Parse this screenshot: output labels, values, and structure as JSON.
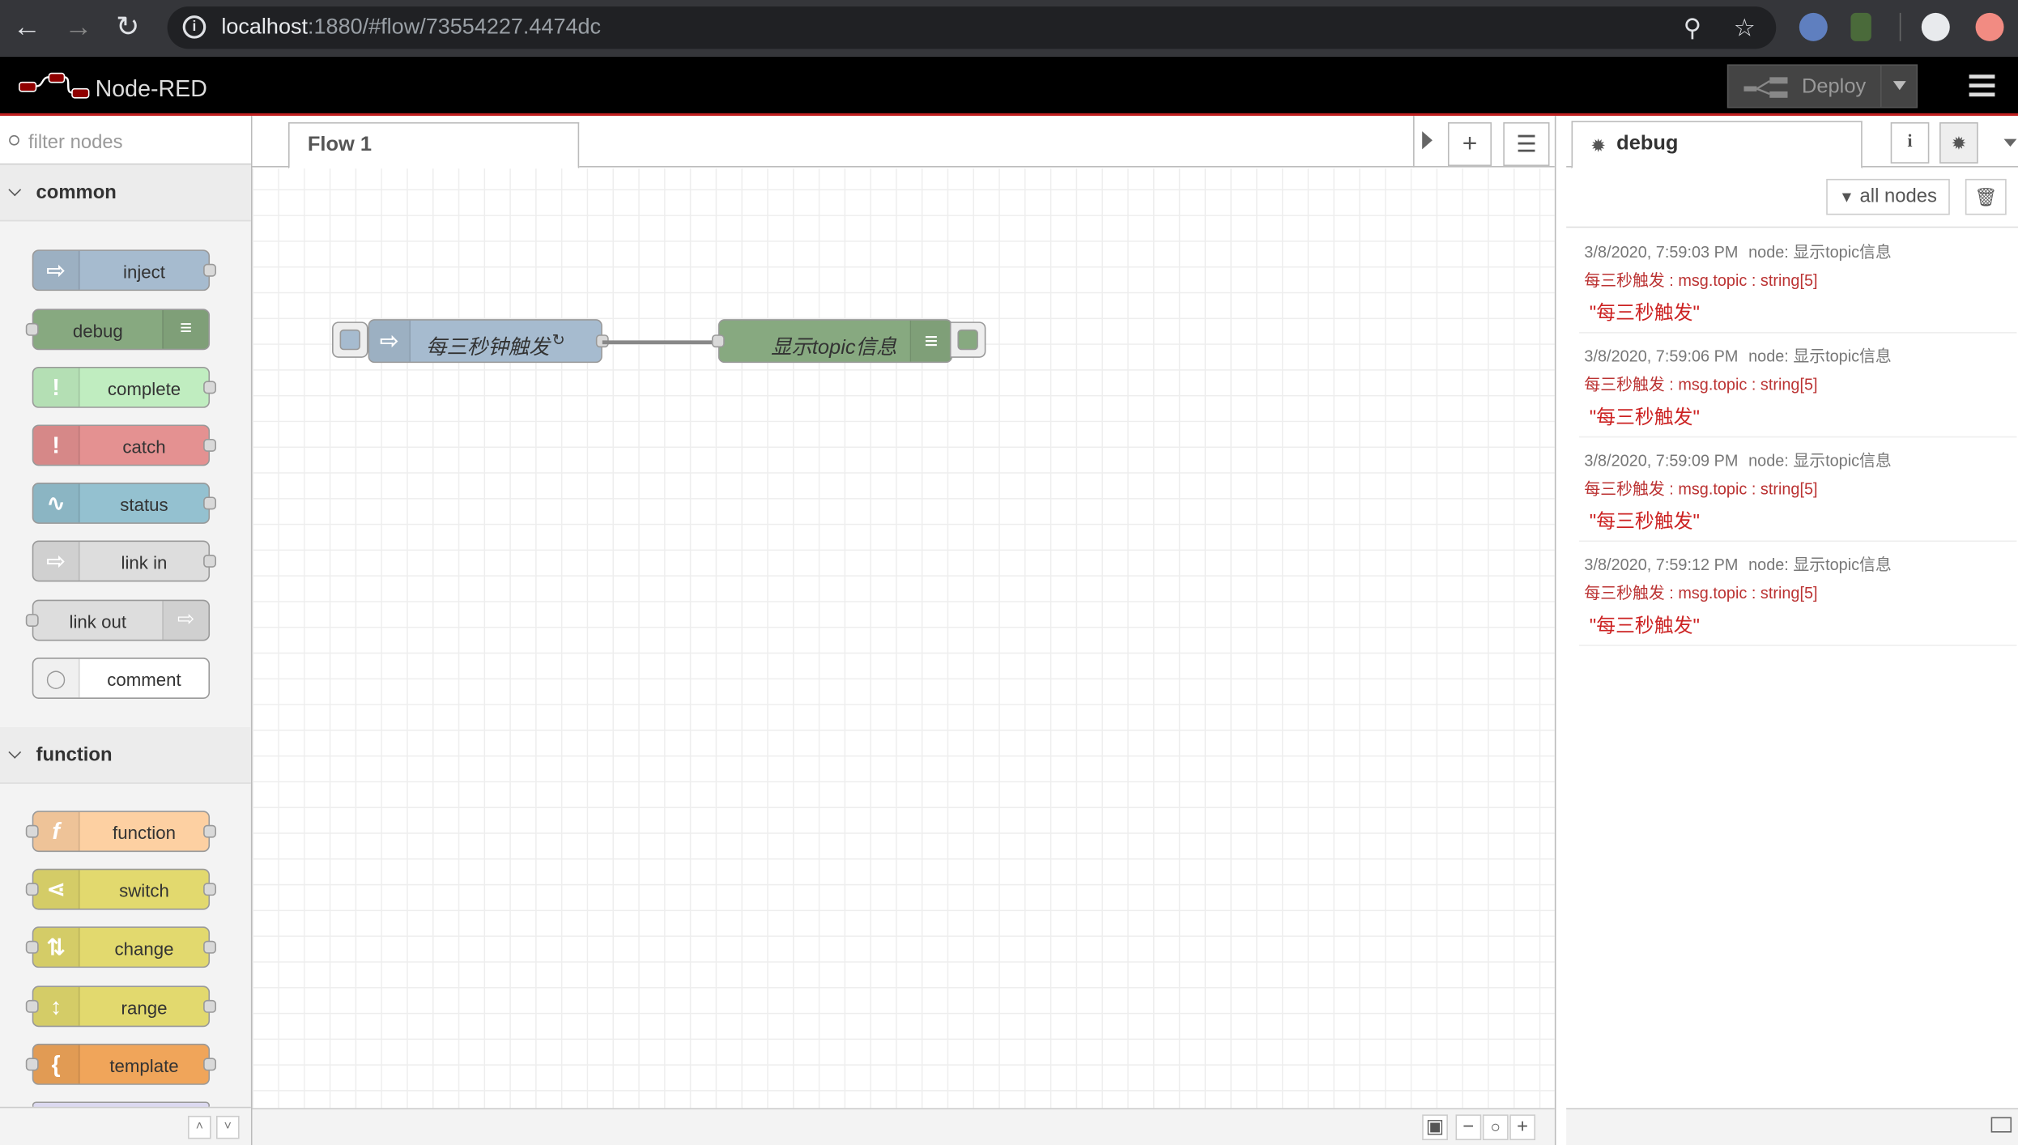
{
  "browser": {
    "url_host": "localhost",
    "url_rest": ":1880/#flow/73554227.4474dc"
  },
  "header": {
    "app_title": "Node-RED",
    "deploy_label": "Deploy"
  },
  "palette": {
    "filter_placeholder": "filter nodes",
    "categories": [
      {
        "label": "common",
        "nodes": [
          {
            "label": "inject",
            "color": "#a6bbcf"
          },
          {
            "label": "debug",
            "color": "#87a980"
          },
          {
            "label": "complete",
            "color": "#c0edc0"
          },
          {
            "label": "catch",
            "color": "#e49191"
          },
          {
            "label": "status",
            "color": "#94c1d0"
          },
          {
            "label": "link in",
            "color": "#dddddd"
          },
          {
            "label": "link out",
            "color": "#dddddd"
          },
          {
            "label": "comment",
            "color": "#ffffff"
          }
        ]
      },
      {
        "label": "function",
        "nodes": [
          {
            "label": "function",
            "color": "#fdd0a2"
          },
          {
            "label": "switch",
            "color": "#e2d96e"
          },
          {
            "label": "change",
            "color": "#e2d96e"
          },
          {
            "label": "range",
            "color": "#e2d96e"
          },
          {
            "label": "template",
            "color": "#f0a55a"
          }
        ]
      }
    ]
  },
  "workspace": {
    "tab_label": "Flow 1",
    "flow_nodes": [
      {
        "label": "每三秒钟触发",
        "color": "#a6bbcf"
      },
      {
        "label": "显示topic信息",
        "color": "#87a980"
      }
    ]
  },
  "sidebar": {
    "tab_label": "debug",
    "filter_label": "all nodes",
    "messages": [
      {
        "time": "3/8/2020, 7:59:03 PM",
        "node": "node: 显示topic信息",
        "path": "每三秒触发 : msg.topic : string[5]",
        "value": "\"每三秒触发\""
      },
      {
        "time": "3/8/2020, 7:59:06 PM",
        "node": "node: 显示topic信息",
        "path": "每三秒触发 : msg.topic : string[5]",
        "value": "\"每三秒触发\""
      },
      {
        "time": "3/8/2020, 7:59:09 PM",
        "node": "node: 显示topic信息",
        "path": "每三秒触发 : msg.topic : string[5]",
        "value": "\"每三秒触发\""
      },
      {
        "time": "3/8/2020, 7:59:12 PM",
        "node": "node: 显示topic信息",
        "path": "每三秒触发 : msg.topic : string[5]",
        "value": "\"每三秒触发\""
      }
    ]
  }
}
